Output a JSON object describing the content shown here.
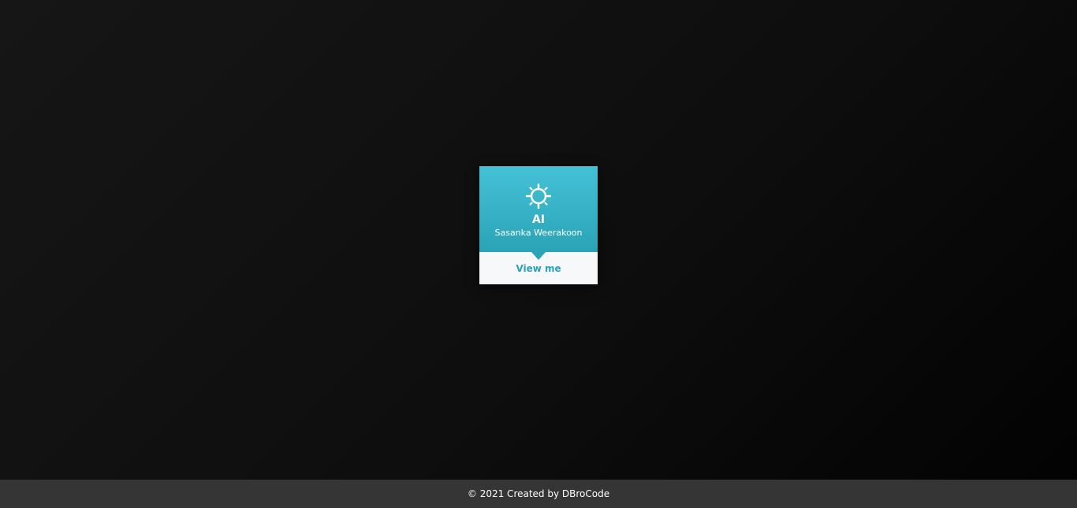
{
  "card": {
    "icon": "sun-icon",
    "title": "AI",
    "subtitle": "Sasanka Weerakoon",
    "action_label": "View me",
    "accent_color": "#2aa3b6",
    "accent_color_light": "#45c1d6"
  },
  "footer": {
    "text": "© 2021 Created by DBroCode"
  },
  "colors": {
    "background": "#0e0e0e",
    "footer_background": "#353535",
    "card_bottom_background": "#f7f8f9"
  }
}
